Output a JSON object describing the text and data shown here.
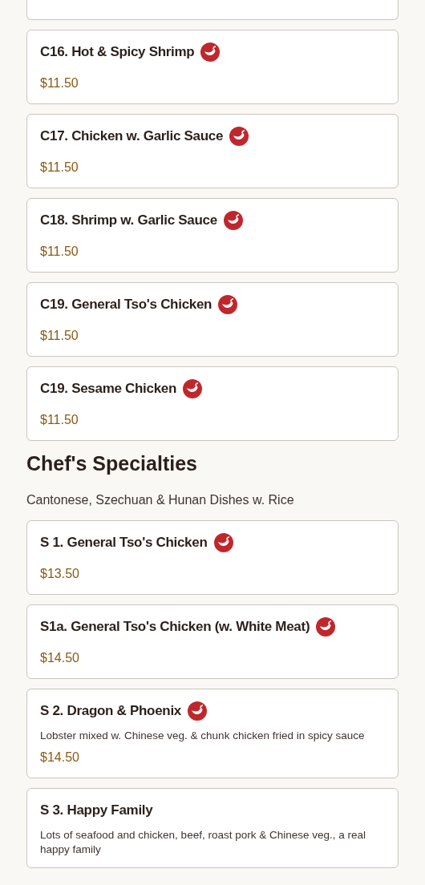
{
  "sections": [
    {
      "items": [
        {
          "name": "C16. Hot & Spicy Shrimp",
          "spicy": true,
          "price": "$11.50"
        },
        {
          "name": "C17. Chicken w. Garlic Sauce",
          "spicy": true,
          "price": "$11.50"
        },
        {
          "name": "C18. Shrimp w. Garlic Sauce",
          "spicy": true,
          "price": "$11.50"
        },
        {
          "name": "C19. General Tso's Chicken",
          "spicy": true,
          "price": "$11.50"
        },
        {
          "name": "C19. Sesame Chicken",
          "spicy": true,
          "price": "$11.50"
        }
      ]
    },
    {
      "title": "Chef's Specialties",
      "subtitle": "Cantonese, Szechuan & Hunan Dishes w. Rice",
      "items": [
        {
          "name": "S 1. General Tso's Chicken",
          "spicy": true,
          "price": "$13.50"
        },
        {
          "name": "S1a. General Tso's Chicken (w. White Meat)",
          "spicy": true,
          "price": "$14.50"
        },
        {
          "name": "S 2. Dragon & Phoenix",
          "spicy": true,
          "description": "Lobster mixed w. Chinese veg. & chunk chicken fried in spicy sauce",
          "price": "$14.50"
        },
        {
          "name": "S 3. Happy Family",
          "spicy": false,
          "description": "Lots of seafood and chicken, beef, roast pork & Chinese veg., a real happy family"
        }
      ]
    }
  ]
}
